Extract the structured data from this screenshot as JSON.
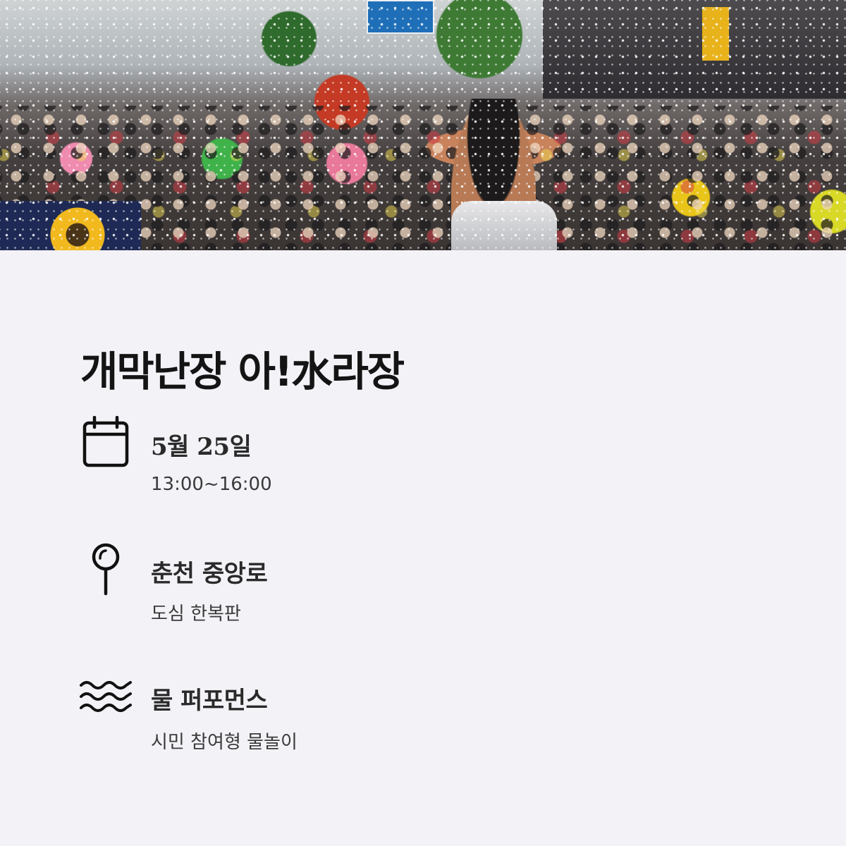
{
  "hero": {
    "photo": "crowd-water-festival-photo"
  },
  "title": "개막난장 아!水라장",
  "items": [
    {
      "icon": "calendar-icon",
      "heading": "5월 25일",
      "sub": "13:00~16:00"
    },
    {
      "icon": "map-pin-icon",
      "heading": "춘천 중앙로",
      "sub": "도심 한복판"
    },
    {
      "icon": "water-waves-icon",
      "heading": "물 퍼포먼스",
      "sub": "시민 참여형 물놀이"
    }
  ],
  "colors": {
    "background": "#f3f2f7",
    "text": "#141414",
    "icon": "#111111"
  }
}
